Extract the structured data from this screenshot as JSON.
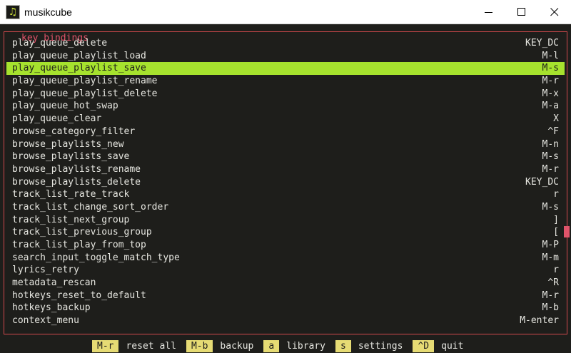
{
  "window": {
    "title": "musikcube",
    "icon_glyph": "♫"
  },
  "panel": {
    "title": "key bindings"
  },
  "bindings": [
    {
      "action": "play_queue_delete",
      "key": "KEY_DC"
    },
    {
      "action": "play_queue_playlist_load",
      "key": "M-l"
    },
    {
      "action": "play_queue_playlist_save",
      "key": "M-s",
      "selected": true
    },
    {
      "action": "play_queue_playlist_rename",
      "key": "M-r"
    },
    {
      "action": "play_queue_playlist_delete",
      "key": "M-x"
    },
    {
      "action": "play_queue_hot_swap",
      "key": "M-a"
    },
    {
      "action": "play_queue_clear",
      "key": "X"
    },
    {
      "action": "browse_category_filter",
      "key": "^F"
    },
    {
      "action": "browse_playlists_new",
      "key": "M-n"
    },
    {
      "action": "browse_playlists_save",
      "key": "M-s"
    },
    {
      "action": "browse_playlists_rename",
      "key": "M-r"
    },
    {
      "action": "browse_playlists_delete",
      "key": "KEY_DC"
    },
    {
      "action": "track_list_rate_track",
      "key": "r"
    },
    {
      "action": "track_list_change_sort_order",
      "key": "M-s"
    },
    {
      "action": "track_list_next_group",
      "key": "]"
    },
    {
      "action": "track_list_previous_group",
      "key": "["
    },
    {
      "action": "track_list_play_from_top",
      "key": "M-P"
    },
    {
      "action": "search_input_toggle_match_type",
      "key": "M-m"
    },
    {
      "action": "lyrics_retry",
      "key": "r"
    },
    {
      "action": "metadata_rescan",
      "key": "^R"
    },
    {
      "action": "hotkeys_reset_to_default",
      "key": "M-r"
    },
    {
      "action": "hotkeys_backup",
      "key": "M-b"
    },
    {
      "action": "context_menu",
      "key": "M-enter"
    }
  ],
  "shortcuts": [
    {
      "key": "M-r",
      "label": "reset all"
    },
    {
      "key": "M-b",
      "label": "backup"
    },
    {
      "key": "a",
      "label": "library"
    },
    {
      "key": "s",
      "label": "settings"
    },
    {
      "key": "^D",
      "label": "quit"
    }
  ],
  "colors": {
    "background": "#1e1e1b",
    "selection": "#a6e22e",
    "frame_border": "#d0494c",
    "shortcut_key": "#e6db74",
    "scrollbar": "#e0546a"
  }
}
